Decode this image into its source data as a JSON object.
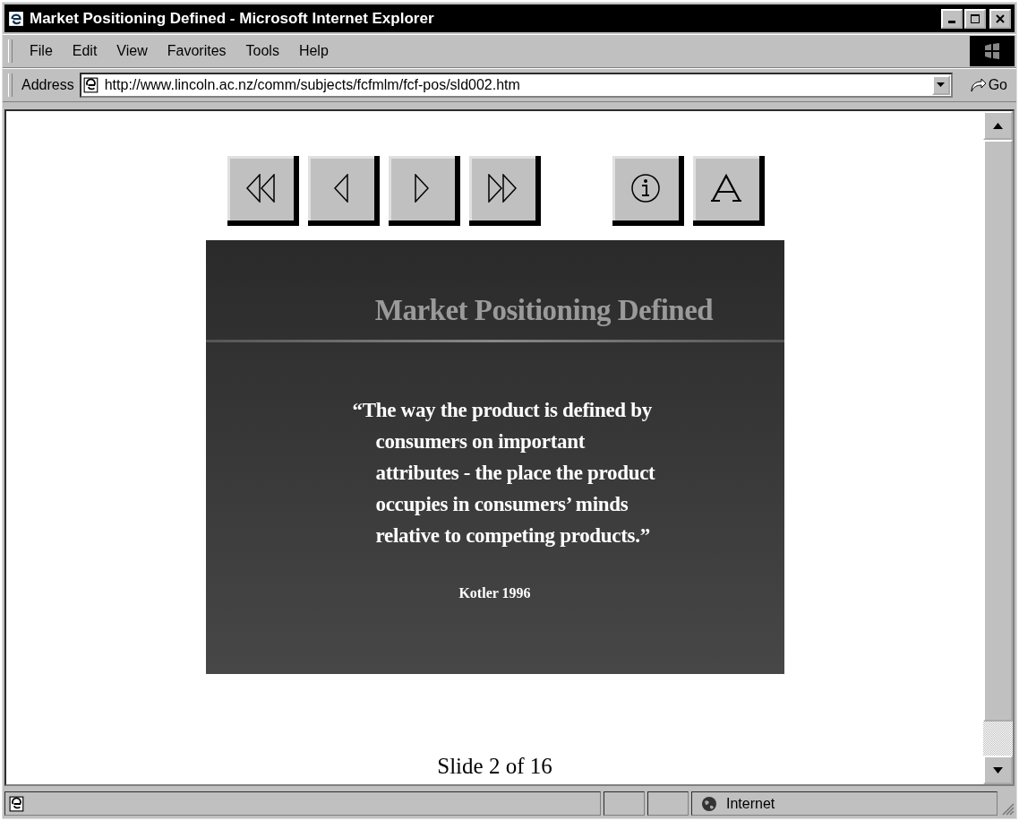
{
  "window": {
    "title": "Market Positioning Defined - Microsoft Internet Explorer"
  },
  "menu": [
    {
      "label": "File"
    },
    {
      "label": "Edit"
    },
    {
      "label": "View"
    },
    {
      "label": "Favorites"
    },
    {
      "label": "Tools"
    },
    {
      "label": "Help"
    }
  ],
  "address_bar": {
    "label": "Address",
    "value": "http://www.lincoln.ac.nz/comm/subjects/fcfmlm/fcf-pos/sld002.htm",
    "go": "Go"
  },
  "nav_buttons": [
    {
      "kind": "first"
    },
    {
      "kind": "prev"
    },
    {
      "kind": "next"
    },
    {
      "kind": "last"
    },
    {
      "kind": "info"
    },
    {
      "kind": "text"
    }
  ],
  "slide": {
    "title": "Market Positioning Defined",
    "quote": "“The way the product is defined by\nconsumers on important\nattributes - the place the product\noccupies in consumers’ minds\nrelative to competing products.”",
    "source": "Kotler 1996"
  },
  "slide_counter": "Slide 2 of 16",
  "status_bar": {
    "zone": "Internet"
  }
}
